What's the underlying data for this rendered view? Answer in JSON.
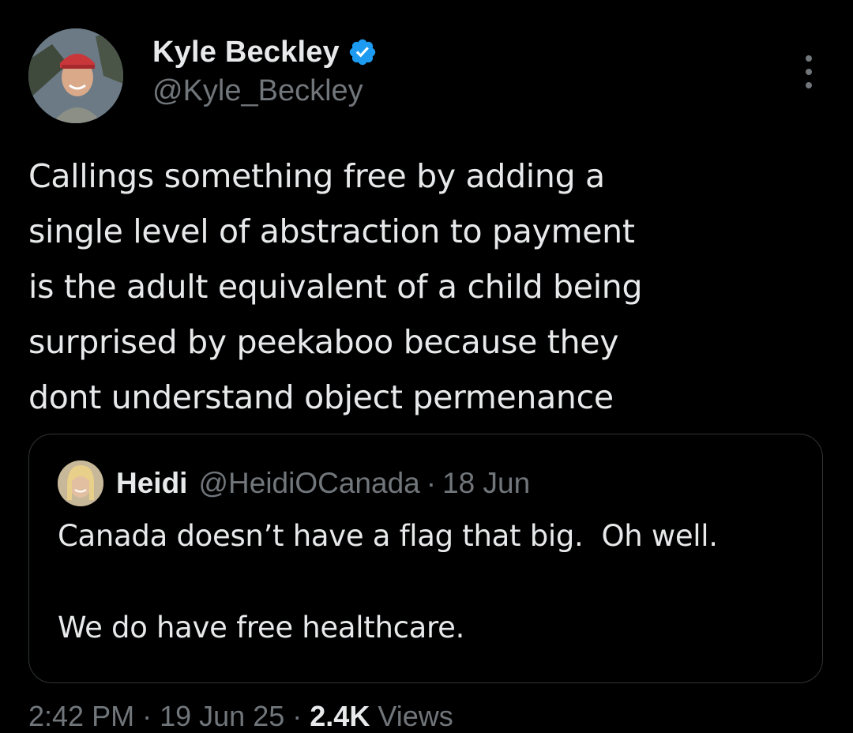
{
  "author": {
    "display_name": "Kyle Beckley",
    "handle": "@Kyle_Beckley",
    "verified": true,
    "verified_color": "#1d9bf0",
    "avatar_icon": "profile-photo"
  },
  "tweet": {
    "text": "Callings something free by adding a\nsingle level of abstraction to payment\nis the adult equivalent of a child being\nsurprised by peekaboo because they\ndont understand object permenance"
  },
  "quoted_tweet": {
    "display_name": "Heidi",
    "handle": "@HeidiOCanada",
    "separator": "·",
    "date": "18 Jun",
    "text": "Canada doesn’t have a flag that big.  Oh well.\n\nWe do have free healthcare.",
    "avatar_icon": "profile-photo"
  },
  "footer": {
    "time": "2:42 PM",
    "separator": "·",
    "date": "19 Jun 25",
    "views_count": "2.4K",
    "views_label": "Views"
  },
  "colors": {
    "background": "#000000",
    "primary_text": "#e7e9ea",
    "secondary_text": "#71767b",
    "border": "#2f3336"
  }
}
